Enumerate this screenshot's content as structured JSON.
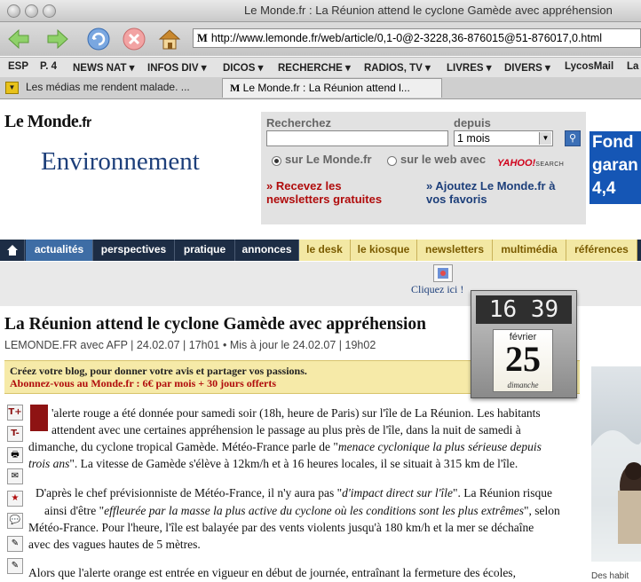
{
  "window": {
    "title": "Le Monde.fr : La Réunion attend le cyclone Gamède avec appréhension"
  },
  "toolbar": {
    "url": "http://www.lemonde.fr/web/article/0,1-0@2-3228,36-876015@51-876017,0.html",
    "site_icon": "M"
  },
  "bookmarks": [
    "ESP",
    "P. 4",
    "NEWS NAT ▾",
    "INFOS DIV ▾",
    "DICOS ▾",
    "RECHERCHE ▾",
    "RADIOS, TV ▾",
    "LIVRES ▾",
    "DIVERS ▾",
    "LycosMail",
    "La"
  ],
  "tabs": [
    {
      "label": "Les médias me rendent malade. ..."
    },
    {
      "label": "Le Monde.fr : La Réunion attend l..."
    }
  ],
  "header": {
    "logo": "Le Monde",
    "logo_suffix": ".fr",
    "section": "Environnement"
  },
  "search": {
    "label": "Recherchez",
    "since_label": "depuis",
    "since_value": "1 mois",
    "radio1": "sur Le Monde.fr",
    "radio2": "sur le web avec",
    "yahoo": "YAHOO!",
    "yahoo_suffix": "SEARCH",
    "newsletter_link": "» Recevez les newsletters gratuites",
    "favorites_link": "» Ajoutez Le Monde.fr à vos favoris"
  },
  "ad": {
    "line1": "Fond",
    "line2": "garan",
    "line3": "4,4"
  },
  "nav": {
    "items": [
      "actualités",
      "perspectives",
      "pratique",
      "annonces"
    ],
    "yellow_items": [
      "le desk",
      "le kiosque",
      "newsletters",
      "multimédia",
      "références"
    ]
  },
  "promo_banner": {
    "cta": "Cliquez ici !"
  },
  "article": {
    "headline": "La Réunion attend le cyclone Gamède avec appréhension",
    "byline": "LEMONDE.FR avec AFP | 24.02.07 | 17h01  •  Mis à jour le 24.02.07 | 19h02",
    "promo_line1": "Créez votre blog, pour donner votre avis et partager vos passions.",
    "promo_line2": "Abonnez-vous au Monde.fr : 6€ par mois + 30 jours offerts",
    "dropcap": "L",
    "p1_line1": "'alerte rouge a été donnée pour samedi soir (18h, heure de Paris) sur l'île de La Réunion. Les habitants",
    "p1_line2": "attendent avec une certaines appréhension le passage au plus près de l'île, dans la nuit de samedi à",
    "p1_line3a": "dimanche, du cyclone tropical Gamède. Météo-France parle de \"",
    "p1_line3b": "menace cyclonique la plus sérieuse depuis",
    "p1_line4a": "trois ans",
    "p1_line4b": "\". La vitesse de Gamède s'élève à 12km/h et à 16 heures locales, il se situait à 315 km de l'île.",
    "p2_line1a": "D'après le chef prévisionniste de Météo-France, il n'y aura pas \"",
    "p2_line1b": "d'impact direct sur l'île",
    "p2_line1c": "\". La Réunion risque",
    "p2_line2a": "ainsi d'être \"",
    "p2_line2b": "effleurée par la masse la plus active du cyclone où les conditions sont les plus extrêmes",
    "p2_line2c": "\", selon",
    "p2_line3": "Météo-France. Pour l'heure, l'île est balayée par des vents violents jusqu'à 180 km/h et la mer se déchaîne",
    "p2_line4": "avec des vagues hautes de 5 mètres.",
    "p3_line1": "Alors que l'alerte orange est entrée en vigueur en début de journée, entraînant la fermeture des écoles,",
    "photo_caption": "Des habit",
    "tools": [
      "T+",
      "T-",
      "print-icon",
      "mail-icon",
      "star-icon",
      "chat-icon",
      "note-icon",
      "note-icon-2"
    ]
  },
  "widget": {
    "time": "16 39",
    "month": "février",
    "day": "25",
    "weekday": "dimanche"
  }
}
